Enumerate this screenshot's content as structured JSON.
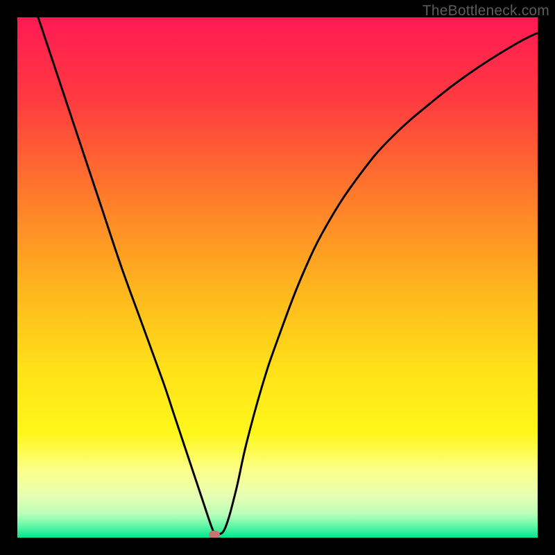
{
  "watermark": "TheBottleneck.com",
  "marker_color": "#c97373",
  "curve_color": "#000000",
  "curve_width": 3,
  "gradient_stops": [
    {
      "offset": 0,
      "color": "#ff1a53"
    },
    {
      "offset": 0.16,
      "color": "#ff3b40"
    },
    {
      "offset": 0.34,
      "color": "#ff7a2b"
    },
    {
      "offset": 0.52,
      "color": "#ffb51e"
    },
    {
      "offset": 0.68,
      "color": "#ffe219"
    },
    {
      "offset": 0.8,
      "color": "#fff71a"
    },
    {
      "offset": 0.87,
      "color": "#fcff8a"
    },
    {
      "offset": 0.92,
      "color": "#e7ffb3"
    },
    {
      "offset": 0.955,
      "color": "#b9ffb9"
    },
    {
      "offset": 0.978,
      "color": "#60f6a6"
    },
    {
      "offset": 1.0,
      "color": "#00e78e"
    }
  ],
  "chart_data": {
    "type": "line",
    "title": "",
    "xlabel": "",
    "ylabel": "",
    "xlim": [
      0,
      100
    ],
    "ylim": [
      0,
      100
    ],
    "legend": false,
    "grid": false,
    "series": [
      {
        "name": "bottleneck-curve",
        "x": [
          0,
          4,
          8,
          12,
          16,
          20,
          24,
          28,
          30,
          32,
          34,
          36,
          37,
          37.8,
          38.6,
          40,
          42,
          44,
          47,
          50,
          55,
          60,
          66,
          72,
          80,
          88,
          96,
          100
        ],
        "y": [
          112,
          100,
          88,
          76,
          64,
          52,
          41,
          30,
          24,
          18,
          12,
          6,
          3,
          1,
          0.6,
          2,
          9,
          18,
          29,
          38,
          51,
          61,
          70,
          77,
          84,
          90,
          95,
          97
        ]
      }
    ],
    "marker": {
      "x": 37.8,
      "y": 0.6,
      "shape": "pill",
      "color": "#c97373"
    },
    "notes": "Background is a vertical rainbow gradient from red (top) to green (bottom) with a warm-to-cool bottleneck style. Curve descends from top-left, reaches a sharp minimum near x≈38, then rises with decreasing slope toward the top-right."
  }
}
